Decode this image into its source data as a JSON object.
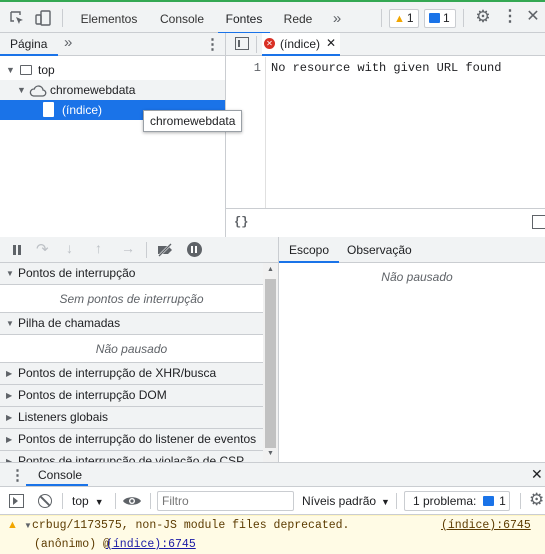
{
  "toolbar": {
    "tabs": [
      "Elementos",
      "Console",
      "Fontes",
      "Rede"
    ],
    "selected_tab": "Fontes",
    "more_tabs": "»",
    "warnings_count": "1",
    "messages_count": "1"
  },
  "navigator": {
    "tab_label": "Página",
    "more": "»",
    "tree": {
      "top": "top",
      "origin": "chromewebdata",
      "file": "(índice)"
    },
    "tooltip": "chromewebdata"
  },
  "editor": {
    "tab_label": "(índice)",
    "line_number": "1",
    "line_text": "No resource with given URL found",
    "pretty_print": "{}"
  },
  "debugger": {
    "sections": [
      {
        "label": "Pontos de interrupção",
        "expanded": true,
        "body": "Sem pontos de interrupção"
      },
      {
        "label": "Pilha de chamadas",
        "expanded": true,
        "body": "Não pausado"
      },
      {
        "label": "Pontos de interrupção de XHR/busca",
        "expanded": false
      },
      {
        "label": "Pontos de interrupção DOM",
        "expanded": false
      },
      {
        "label": "Listeners globais",
        "expanded": false
      },
      {
        "label": "Pontos de interrupção do listener de eventos",
        "expanded": false
      },
      {
        "label": "Pontos de interrupção de violação de CSP",
        "expanded": false
      }
    ]
  },
  "scope": {
    "tabs": [
      "Escopo",
      "Observação"
    ],
    "selected": "Escopo",
    "status": "Não pausado"
  },
  "drawer": {
    "tab_label": "Console",
    "context": "top",
    "filter_placeholder": "Filtro",
    "levels": "Níveis padrão",
    "issues_label": "1 problema:",
    "issues_count": "1"
  },
  "console_messages": [
    {
      "level": "warning",
      "text": "crbug/1173575, non-JS module files deprecated.",
      "source": "(índice):6745",
      "stack_prefix": "(anônimo) @",
      "stack_link": "(índice):6745"
    }
  ],
  "colors": {
    "accent": "#1a73e8",
    "warning_bg": "#fffbe5",
    "warning_icon": "#f2a600",
    "error_icon": "#d93025"
  }
}
